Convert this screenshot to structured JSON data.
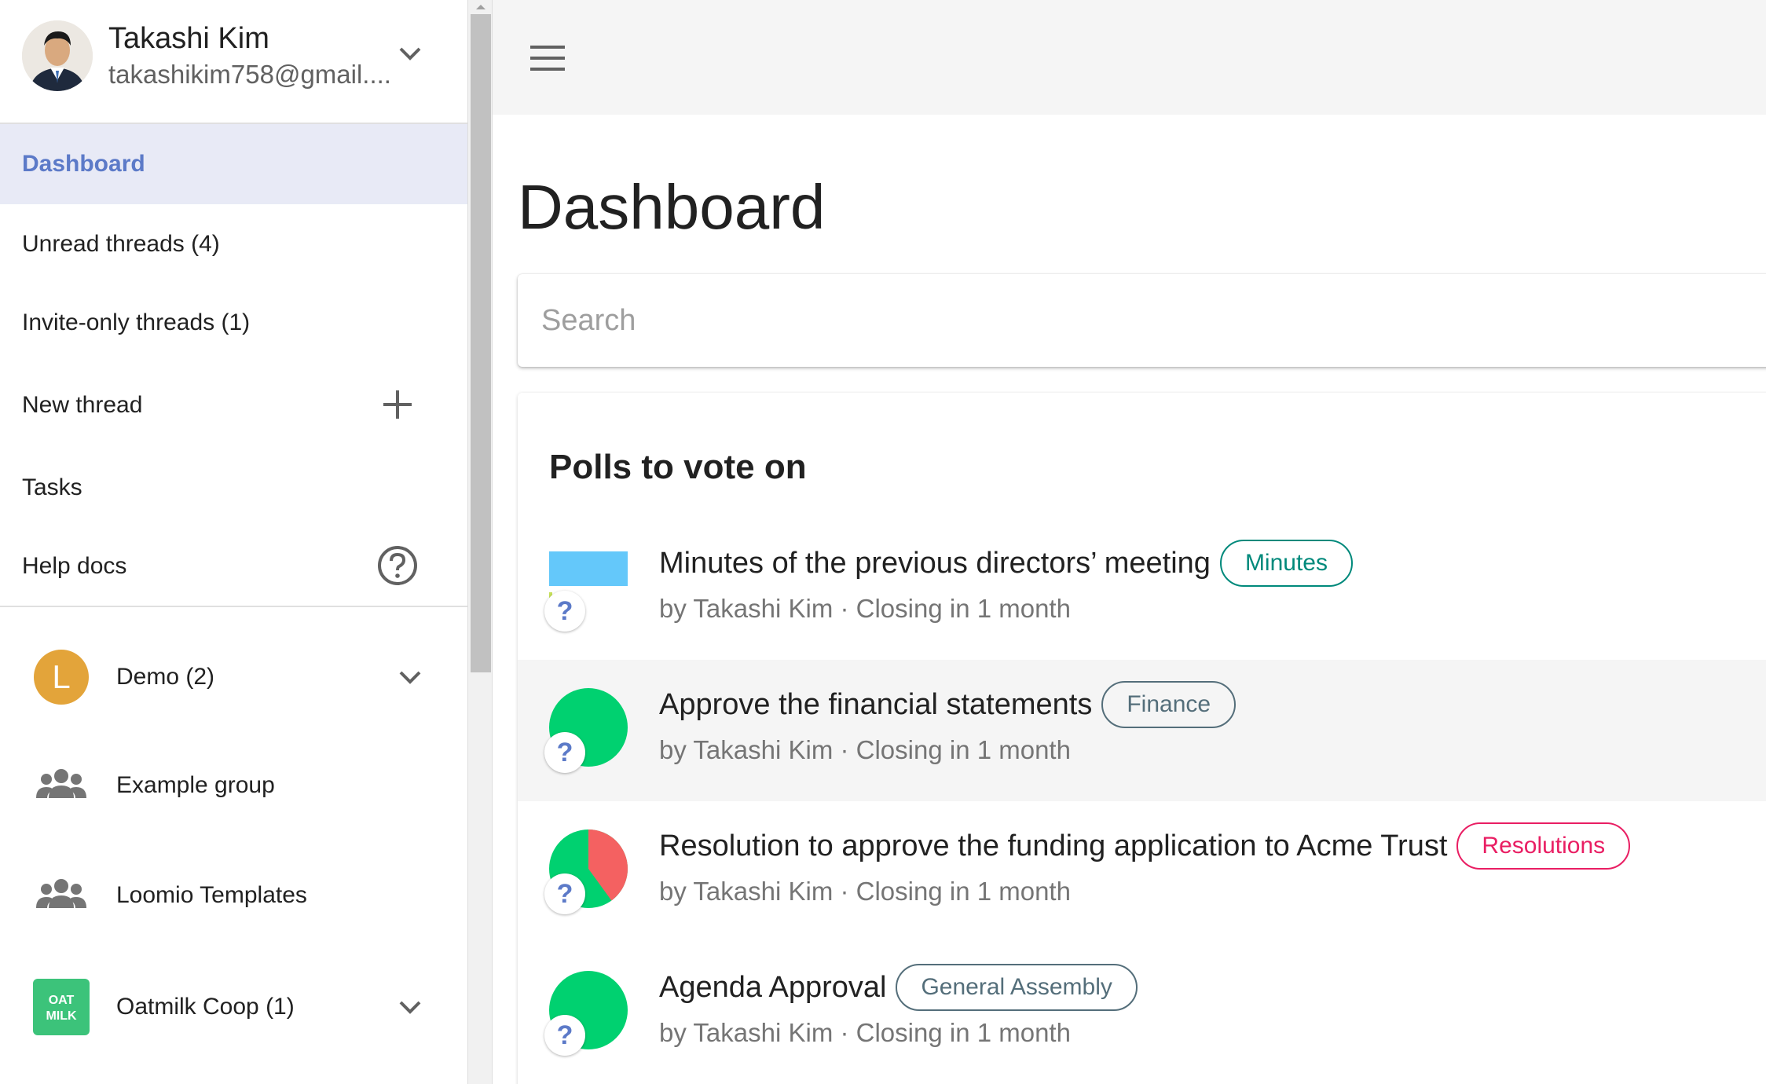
{
  "user": {
    "name": "Takashi Kim",
    "email": "takashikim758@gmail...."
  },
  "nav": {
    "dashboard": "Dashboard",
    "unread": "Unread threads (4)",
    "invite_only": "Invite-only threads (1)",
    "new_thread": "New thread",
    "tasks": "Tasks",
    "help_docs": "Help docs"
  },
  "groups": [
    {
      "label": "Demo (2)",
      "icon_letter": "L",
      "icon": "letter-avatar",
      "color": "#e3a43a"
    },
    {
      "label": "Example group",
      "icon": "group-icon"
    },
    {
      "label": "Loomio Templates",
      "icon": "group-icon"
    },
    {
      "label": "Oatmilk Coop (1)",
      "icon": "oatmilk-logo",
      "color": "#3cc37a",
      "logo_text": "OAT MILK"
    }
  ],
  "main": {
    "page_title": "Dashboard",
    "search_placeholder": "Search",
    "card_title": "Polls to vote on"
  },
  "polls": [
    {
      "title": "Minutes of the previous directors’ meeting",
      "tag": "Minutes",
      "tag_color": "#00897b",
      "meta": "by Takashi Kim · Closing in 1 month",
      "chart": "bars",
      "bar_colors": [
        "#64c8fa",
        "#c6e05a"
      ]
    },
    {
      "title": "Approve the financial statements",
      "tag": "Finance",
      "tag_color": "#546e7a",
      "meta": "by Takashi Kim · Closing in 1 month",
      "chart": "pie",
      "slices": [
        {
          "value": 1.0,
          "color": "#00d170"
        }
      ]
    },
    {
      "title": "Resolution to approve the funding application to Acme Trust",
      "tag": "Resolutions",
      "tag_color": "#e91e63",
      "meta": "by Takashi Kim · Closing in 1 month",
      "chart": "pie",
      "slices": [
        {
          "value": 0.6,
          "color": "#00d170"
        },
        {
          "value": 0.4,
          "color": "#f46161"
        }
      ]
    },
    {
      "title": "Agenda Approval",
      "tag": "General Assembly",
      "tag_color": "#546e7a",
      "meta": "by Takashi Kim · Closing in 1 month",
      "chart": "pie",
      "slices": [
        {
          "value": 1.0,
          "color": "#00d170"
        }
      ]
    }
  ],
  "colors": {
    "accent": "#5c7ac8",
    "active_bg": "#e8eaf6",
    "pie_green": "#00d170",
    "pie_red": "#f46161"
  }
}
